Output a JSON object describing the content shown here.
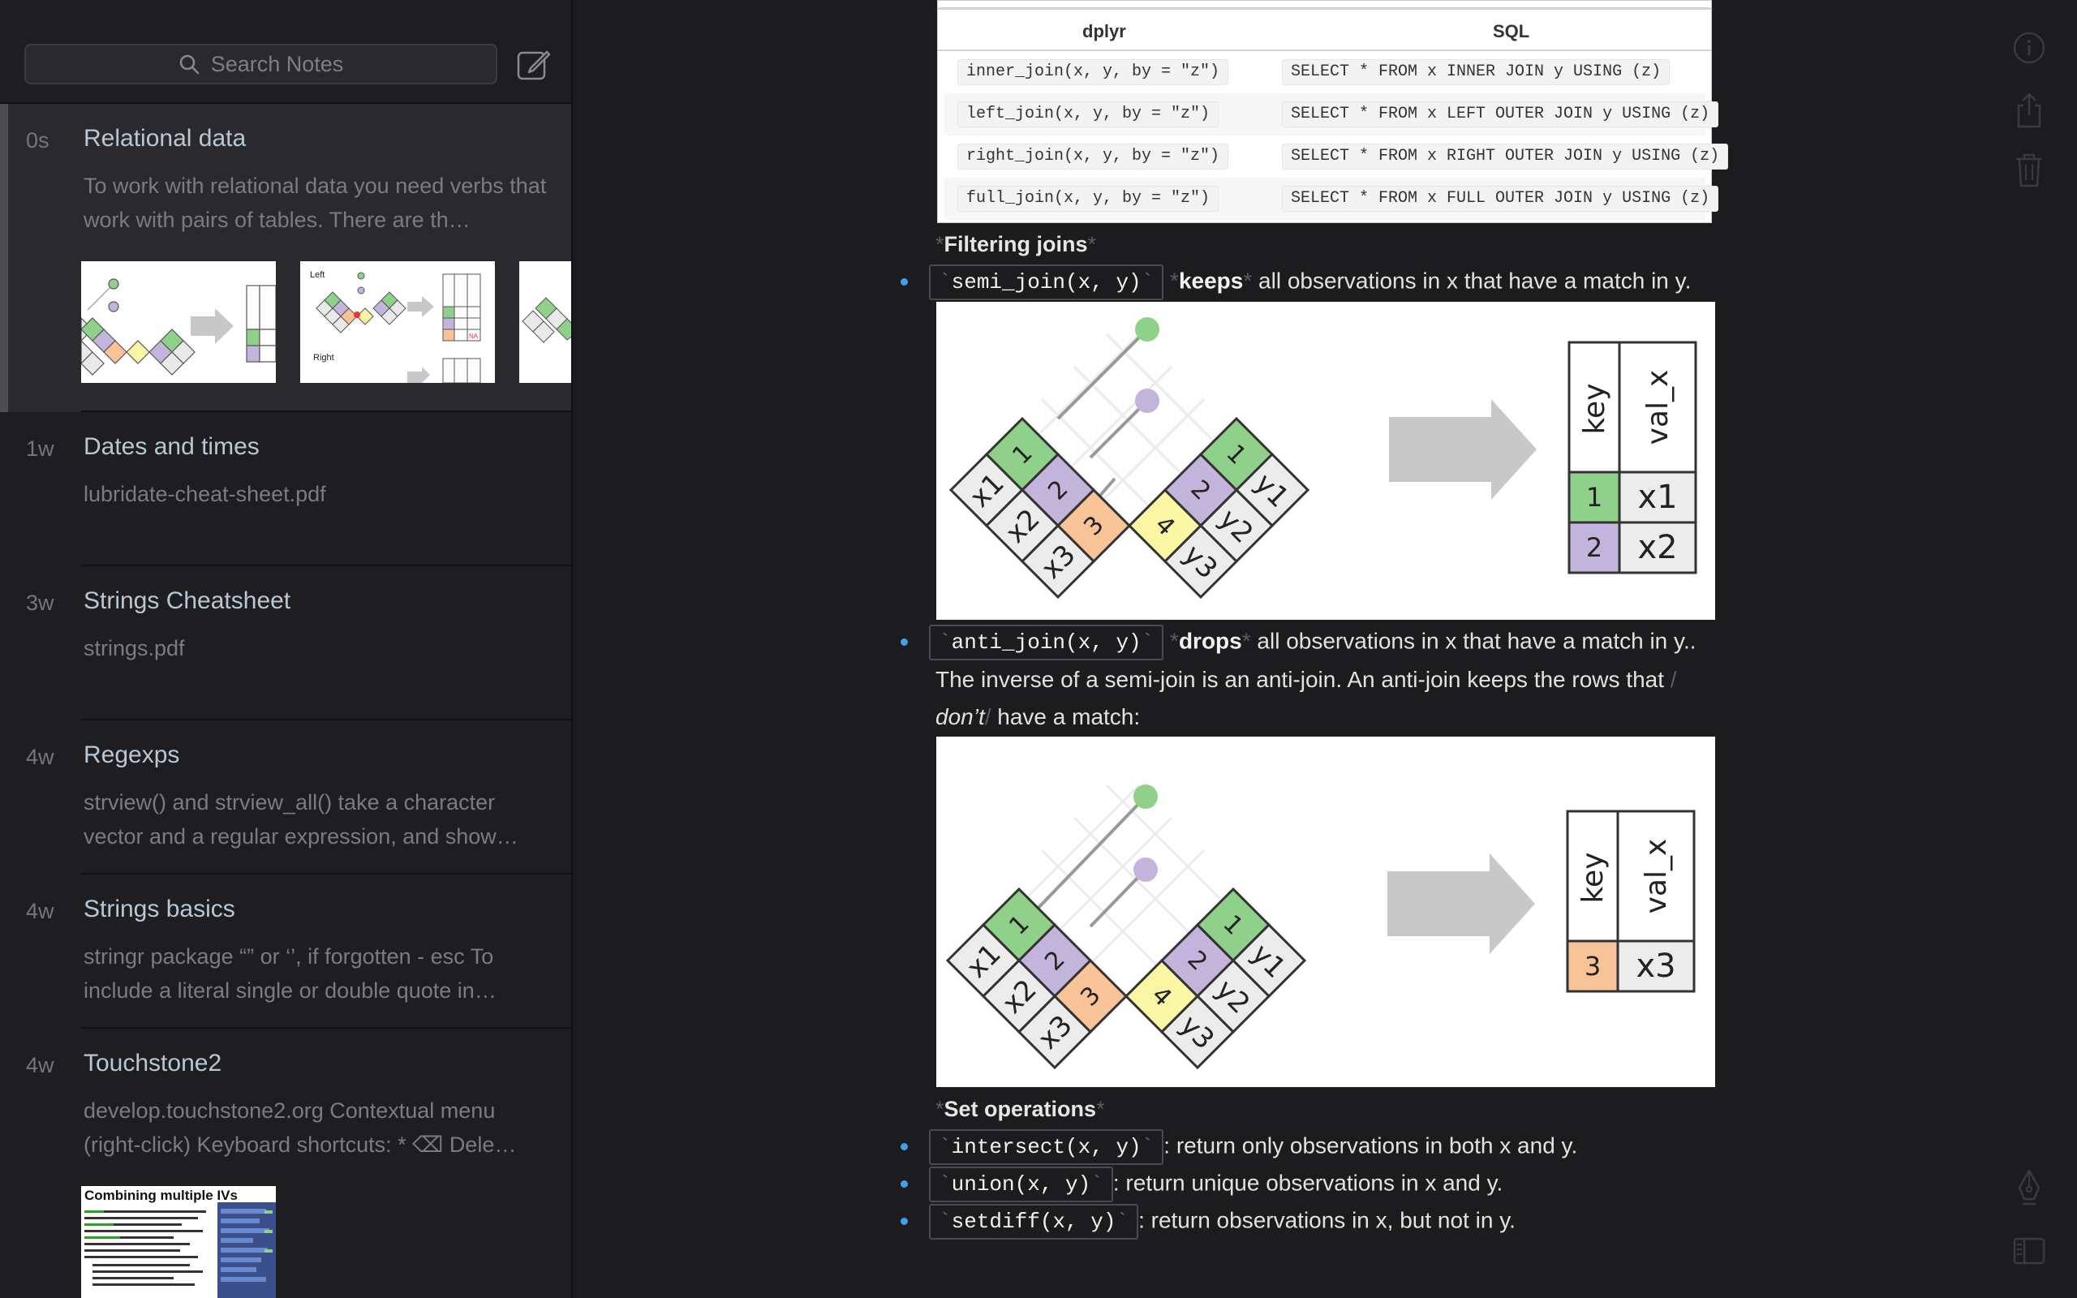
{
  "sidebar": {
    "search_placeholder": "Search Notes",
    "notes": [
      {
        "age": "0s",
        "title": "Relational data",
        "preview": "To work with relational data you need verbs that work with pairs of tables. There are th…",
        "thumb_labels": [
          "Left",
          "Right"
        ]
      },
      {
        "age": "1w",
        "title": "Dates and times",
        "preview": "lubridate-cheat-sheet.pdf"
      },
      {
        "age": "3w",
        "title": "Strings Cheatsheet",
        "preview": "strings.pdf"
      },
      {
        "age": "4w",
        "title": "Regexps",
        "preview": "strview() and strview_all() take a character vector and a regular expression, and show…"
      },
      {
        "age": "4w",
        "title": "Strings basics",
        "preview": "stringr package “” or ‘’, if forgotten - esc To include a literal single or double quote in…"
      },
      {
        "age": "4w",
        "title": "Touchstone2",
        "preview": "develop.touchstone2.org Contextual menu (right-click) Keyboard shortcuts: * ⌫ Dele…",
        "thumb_title": "Combining multiple IVs"
      }
    ]
  },
  "table": {
    "headers": [
      "dplyr",
      "SQL"
    ],
    "rows": [
      [
        "inner_join(x, y, by = \"z\")",
        "SELECT * FROM x INNER JOIN y USING (z)"
      ],
      [
        "left_join(x, y, by = \"z\")",
        "SELECT * FROM x LEFT OUTER JOIN y USING (z)"
      ],
      [
        "right_join(x, y, by = \"z\")",
        "SELECT * FROM x RIGHT OUTER JOIN y USING (z)"
      ],
      [
        "full_join(x, y, by = \"z\")",
        "SELECT * FROM x FULL OUTER JOIN y USING (z)"
      ]
    ]
  },
  "editor": {
    "star": "*",
    "backtick": "`",
    "slash": "/",
    "filtering_heading": "Filtering joins",
    "semi_code": "semi_join(x, y)",
    "semi_verb": "keeps",
    "semi_rest": "all observations in x that have a match in y.",
    "anti_code": "anti_join(x, y)",
    "anti_verb": "drops",
    "anti_rest": "all observations in x that have a match in y..",
    "anti_para_1": "The inverse of a semi-join is an anti-join. An anti-join keeps the rows that",
    "anti_para_em": "don’t",
    "anti_para_2": "have a match:",
    "set_heading": "Set operations",
    "intersect_code": "intersect(x, y)",
    "intersect_text": ": return only observations in both x and y.",
    "union_code": "union(x, y)",
    "union_text": ": return unique observations in x and y.",
    "setdiff_code": "setdiff(x, y)",
    "setdiff_text": ": return observations in x, but not in y."
  },
  "diagram_semi": {
    "x_cells": [
      "x1",
      "x2",
      "x3"
    ],
    "x_keys": [
      "1",
      "2",
      "3"
    ],
    "y_keys": [
      "1",
      "2",
      "4"
    ],
    "y_cells": [
      "y1",
      "y2",
      "y3"
    ],
    "result_headers": [
      "key",
      "val_x"
    ],
    "result_rows": [
      [
        "1",
        "x1"
      ],
      [
        "2",
        "x2"
      ]
    ]
  },
  "diagram_anti": {
    "x_cells": [
      "x1",
      "x2",
      "x3"
    ],
    "x_keys": [
      "1",
      "2",
      "3"
    ],
    "y_keys": [
      "1",
      "2",
      "4"
    ],
    "y_cells": [
      "y1",
      "y2",
      "y3"
    ],
    "result_headers": [
      "key",
      "val_x"
    ],
    "result_rows": [
      [
        "3",
        "x3"
      ]
    ]
  },
  "colors": {
    "key1": "#8fd18a",
    "key2": "#c3b4dc",
    "key3": "#f8c397",
    "key4": "#fbf6a4",
    "arrow": "#c8c8c8",
    "bullet": "#3ea0f0"
  }
}
